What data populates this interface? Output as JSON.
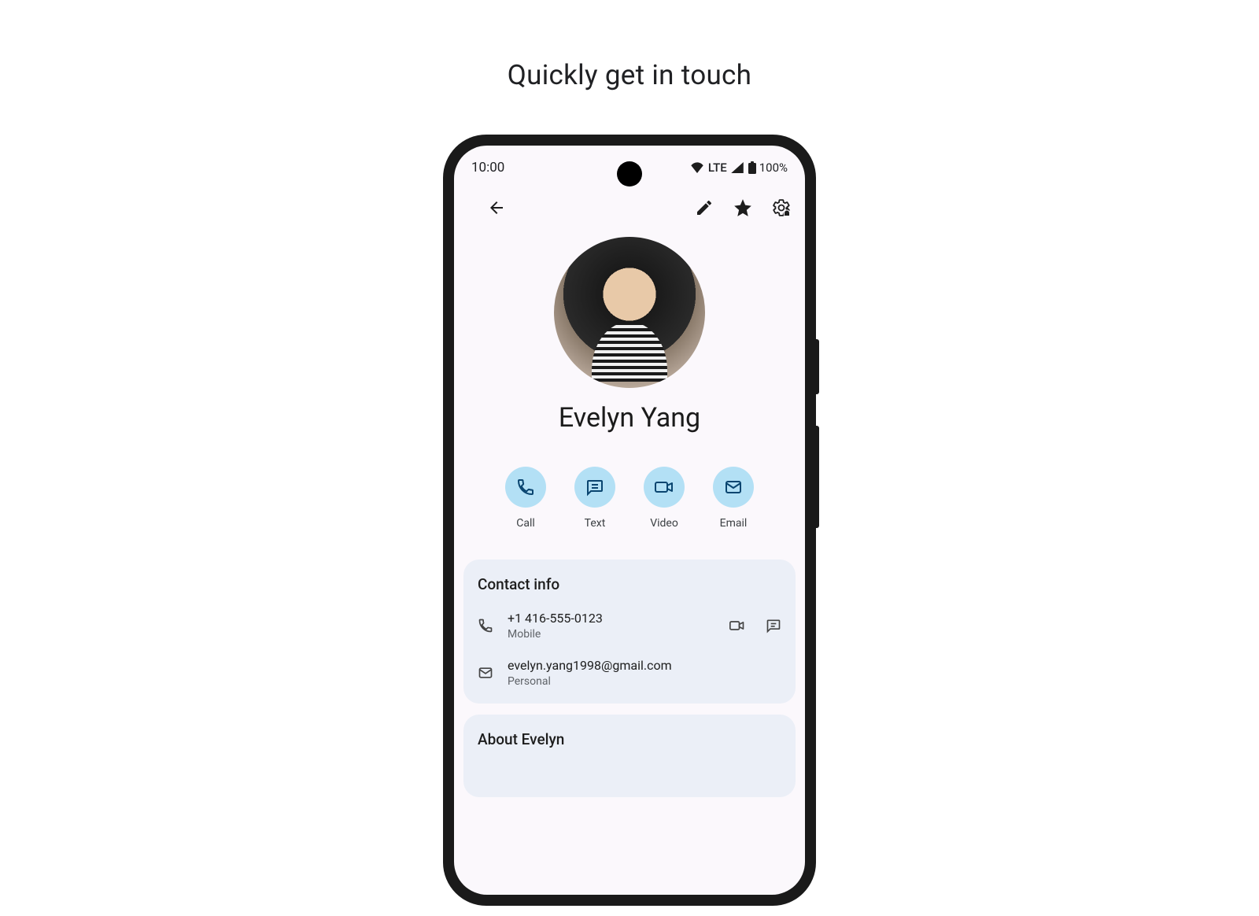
{
  "page": {
    "title": "Quickly get in touch"
  },
  "statusBar": {
    "time": "10:00",
    "network": "LTE",
    "battery": "100%"
  },
  "contact": {
    "name": "Evelyn Yang"
  },
  "quickActions": [
    {
      "label": "Call"
    },
    {
      "label": "Text"
    },
    {
      "label": "Video"
    },
    {
      "label": "Email"
    }
  ],
  "contactInfo": {
    "title": "Contact info",
    "phone": {
      "value": "+1 416-555-0123",
      "label": "Mobile"
    },
    "email": {
      "value": "evelyn.yang1998@gmail.com",
      "label": "Personal"
    }
  },
  "about": {
    "title": "About Evelyn"
  }
}
